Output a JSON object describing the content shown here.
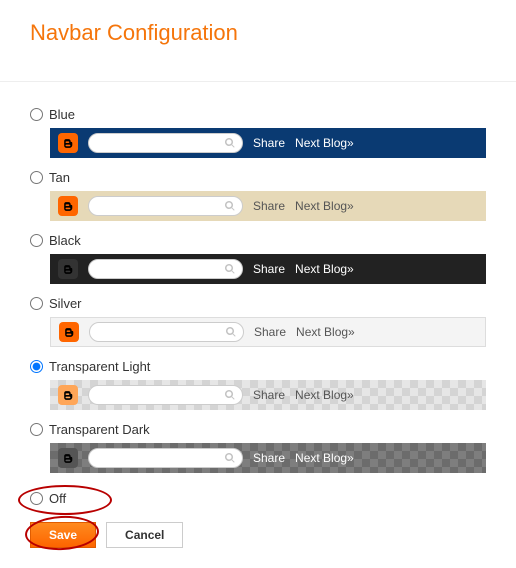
{
  "title": "Navbar Configuration",
  "share_label": "Share",
  "next_label": "Next Blog»",
  "options": {
    "blue": {
      "label": "Blue"
    },
    "tan": {
      "label": "Tan"
    },
    "black": {
      "label": "Black"
    },
    "silver": {
      "label": "Silver"
    },
    "tlight": {
      "label": "Transparent Light"
    },
    "tdark": {
      "label": "Transparent Dark"
    },
    "off": {
      "label": "Off"
    }
  },
  "buttons": {
    "save": "Save",
    "cancel": "Cancel"
  },
  "selected": "tlight",
  "colors": {
    "accent": "#f5750b",
    "blogger_orange": "#ff6600",
    "blue_bar": "#0a3a72",
    "tan_bar": "#e6d9b8",
    "annotation": "#b80000"
  }
}
